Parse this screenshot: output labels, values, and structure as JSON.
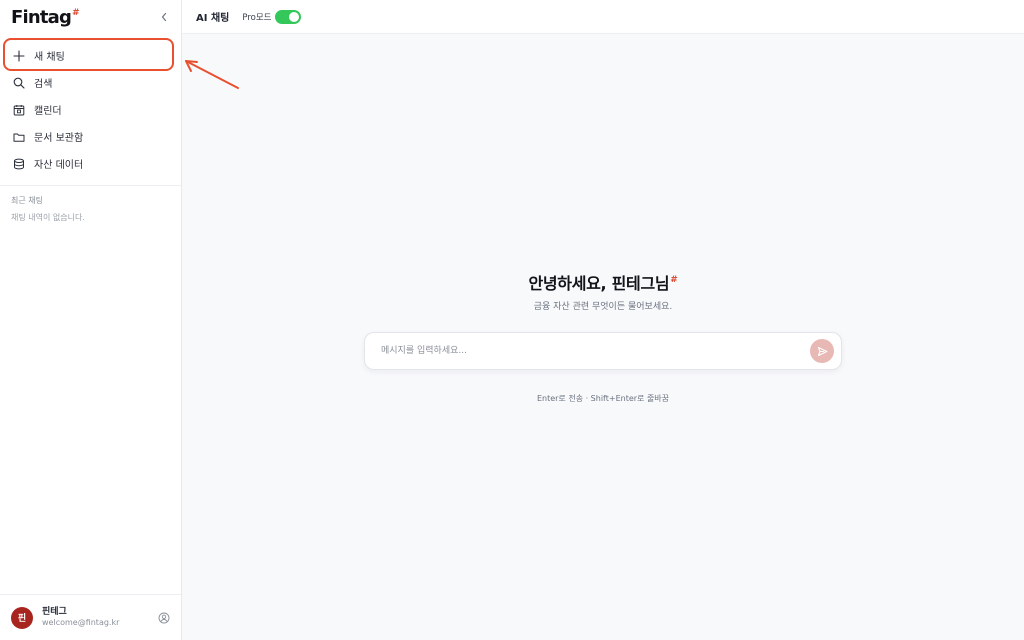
{
  "app": {
    "logo": "Fintag",
    "logo_mark": "#"
  },
  "sidebar": {
    "items": [
      {
        "label": "새 채팅",
        "icon": "plus-icon"
      },
      {
        "label": "검색",
        "icon": "search-icon"
      },
      {
        "label": "캘린더",
        "icon": "calendar-icon"
      },
      {
        "label": "문서 보관함",
        "icon": "folder-icon"
      },
      {
        "label": "자산 데이터",
        "icon": "database-icon"
      }
    ],
    "recent_title": "최근 채팅",
    "recent_empty": "채팅 내역이 없습니다."
  },
  "user": {
    "avatar_text": "핀",
    "name": "핀테그",
    "email": "welcome@fintag.kr"
  },
  "topbar": {
    "title": "AI 채팅",
    "pro_label": "Pro모드",
    "pro_enabled": true
  },
  "greeting": {
    "title": "안녕하세요, 핀테그님",
    "mark": "#",
    "subtitle": "금융 자산 관련 무엇이든 물어보세요."
  },
  "composer": {
    "placeholder": "메시지를 입력하세요...",
    "value": ""
  },
  "hint": "Enter로 전송 · Shift+Enter로 줄바꿈",
  "colors": {
    "accent": "#d9442f",
    "toggle_on": "#34c759",
    "avatar_bg": "#a8251f",
    "send_button": "#e8b8b4",
    "annotation": "#e8502f"
  }
}
